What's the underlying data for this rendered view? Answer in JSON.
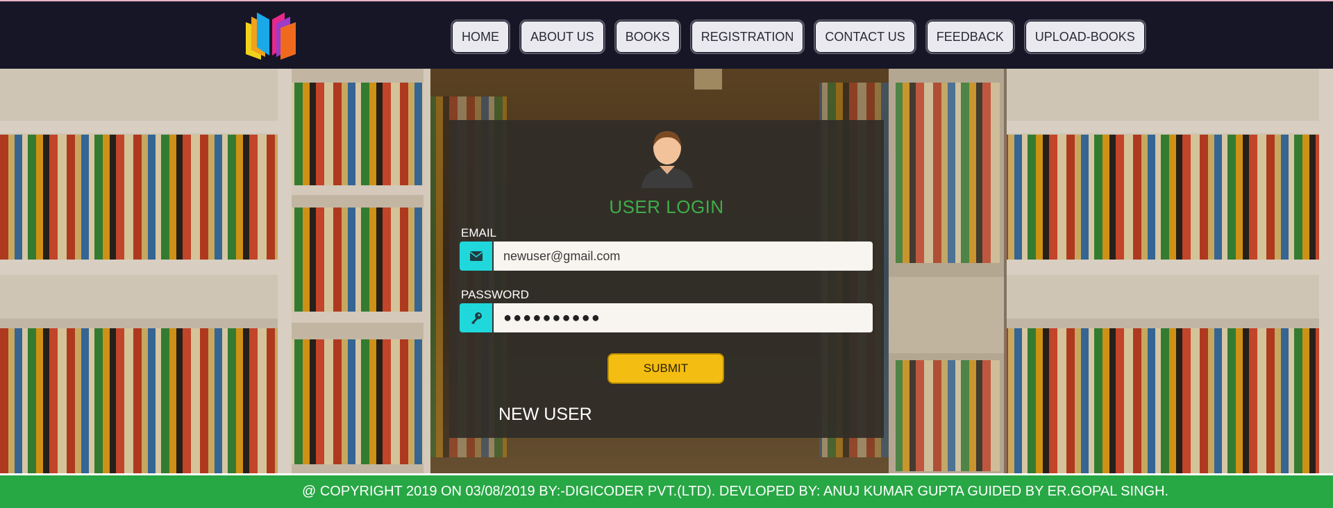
{
  "nav": {
    "items": [
      {
        "label": "HOME"
      },
      {
        "label": "ABOUT US"
      },
      {
        "label": "BOOKS"
      },
      {
        "label": "REGISTRATION"
      },
      {
        "label": "CONTACT US"
      },
      {
        "label": "FEEDBACK"
      },
      {
        "label": "UPLOAD-BOOKS"
      }
    ]
  },
  "login": {
    "title": "USER LOGIN",
    "email_label": "EMAIL",
    "email_value": "newuser@gmail.com",
    "password_label": "PASSWORD",
    "password_mask": "●●●●●●●●●●",
    "submit_label": "SUBMIT",
    "new_user_label": "NEW USER"
  },
  "footer": {
    "text": "@ COPYRIGHT 2019 ON 03/08/2019 BY:-DIGICODER PVT.(LTD). DEVLOPED BY: ANUJ KUMAR GUPTA GUIDED BY ER.GOPAL SINGH."
  },
  "icons": {
    "logo": "books-logo-icon",
    "email": "envelope-icon",
    "password": "key-icon",
    "avatar": "user-avatar-icon"
  },
  "colors": {
    "header_bg": "#161627",
    "title_green": "#3fae49",
    "icon_cyan": "#20d8dc",
    "submit_yellow": "#f4bd12",
    "footer_green": "#28a745"
  }
}
